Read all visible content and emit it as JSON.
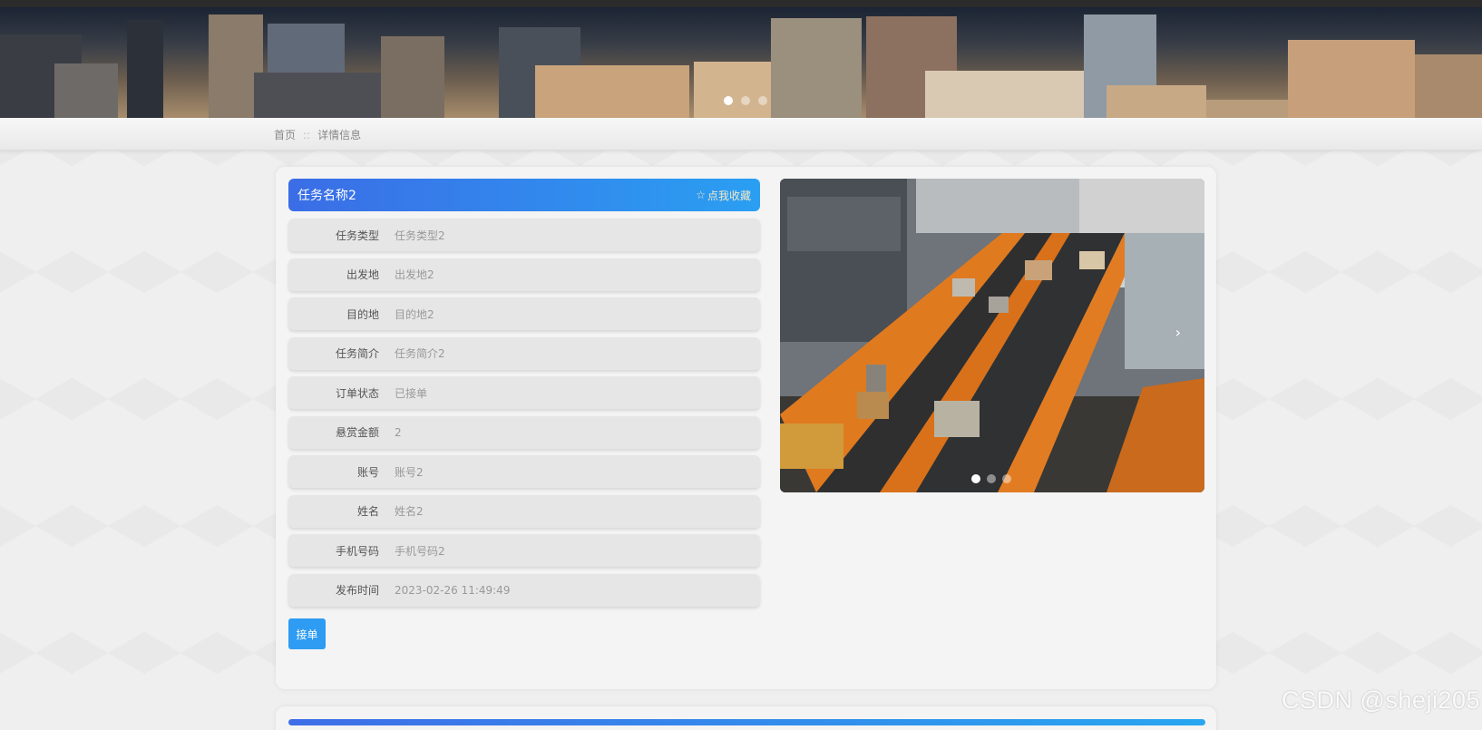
{
  "breadcrumb": {
    "home": "首页",
    "separator": "::",
    "current": "详情信息"
  },
  "detail": {
    "title": "任务名称2",
    "favorite_icon": "star-outline-icon",
    "favorite_glyph": "☆",
    "favorite_label": "点我收藏",
    "rows": [
      {
        "label": "任务类型",
        "value": "任务类型2"
      },
      {
        "label": "出发地",
        "value": "出发地2"
      },
      {
        "label": "目的地",
        "value": "目的地2"
      },
      {
        "label": "任务简介",
        "value": "任务简介2"
      },
      {
        "label": "订单状态",
        "value": "已接单"
      },
      {
        "label": "悬赏金额",
        "value": "2"
      },
      {
        "label": "账号",
        "value": "账号2"
      },
      {
        "label": "姓名",
        "value": "姓名2"
      },
      {
        "label": "手机号码",
        "value": "手机号码2"
      },
      {
        "label": "发布时间",
        "value": "2023-02-26 11:49:49"
      }
    ],
    "accept_button": "接单"
  },
  "carousel": {
    "next_glyph": "›",
    "active_index": 0,
    "count": 3
  },
  "banner": {
    "active_index": 0,
    "count": 3
  },
  "colors": {
    "title_bar_start": "#3b6de6",
    "title_bar_end": "#2a9ff2",
    "button": "#2e9cf2"
  },
  "watermark": "CSDN @sheji205"
}
